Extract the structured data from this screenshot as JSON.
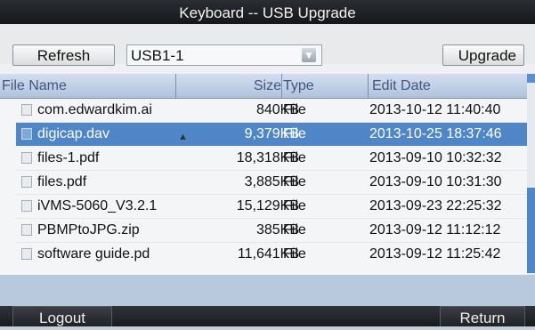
{
  "window": {
    "title": "Keyboard -- USB Upgrade"
  },
  "toolbar": {
    "refresh_label": "Refresh",
    "device_select": {
      "value": "USB1-1"
    },
    "upgrade_label": "Upgrade"
  },
  "table": {
    "columns": [
      "File Name",
      "Size",
      "Type",
      "Edit Date"
    ],
    "rows": [
      {
        "name": "com.edwardkim.ai",
        "size": "840KB",
        "type": "File",
        "date": "2013-10-12 11:40:40",
        "selected": false
      },
      {
        "name": "digicap.dav",
        "size": "9,379KB",
        "type": "File",
        "date": "2013-10-25 18:37:46",
        "selected": true
      },
      {
        "name": "files-1.pdf",
        "size": "18,318KB",
        "type": "File",
        "date": "2013-09-10 10:32:32",
        "selected": false
      },
      {
        "name": "files.pdf",
        "size": "3,885KB",
        "type": "File",
        "date": "2013-09-10 10:31:30",
        "selected": false
      },
      {
        "name": "iVMS-5060_V3.2.1",
        "size": "15,129KB",
        "type": "File",
        "date": "2013-09-23 22:25:32",
        "selected": false
      },
      {
        "name": "PBMPtoJPG.zip",
        "size": "385KB",
        "type": "File",
        "date": "2013-09-12 11:12:12",
        "selected": false
      },
      {
        "name": "software guide.pd",
        "size": "11,641KB",
        "type": "File",
        "date": "2013-09-12 11:25:42",
        "selected": false
      }
    ]
  },
  "footer": {
    "logout_label": "Logout",
    "return_label": "Return"
  },
  "colors": {
    "header_bg": "#afc2db",
    "selected_row": "#4f86c8",
    "titlebar": "#15171a"
  }
}
